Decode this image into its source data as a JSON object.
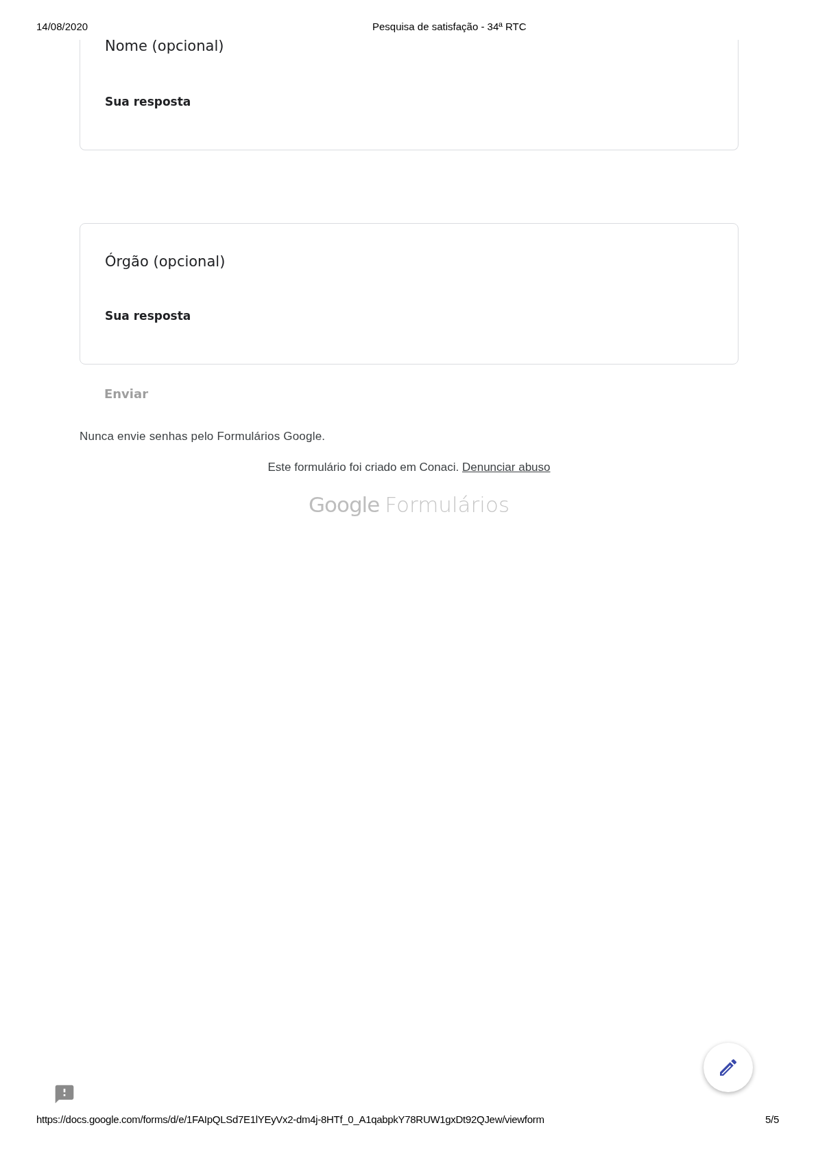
{
  "print_header": {
    "date": "14/08/2020",
    "title": "Pesquisa de satisfação - 34ª RTC"
  },
  "questions": [
    {
      "title": "Nome (opcional)",
      "placeholder": "Sua resposta",
      "top_cut": true
    },
    {
      "title": "Órgão (opcional)",
      "placeholder": "Sua resposta",
      "top_cut": false
    }
  ],
  "submit_button": {
    "label": "Enviar",
    "disabled": true
  },
  "notice": "Nunca envie senhas pelo Formulários Google.",
  "footer": {
    "text": "Este formulário foi criado em Conaci.",
    "link": "Denunciar abuso"
  },
  "logo": {
    "brand": "Google",
    "product": "Formulários"
  },
  "print_footer": {
    "url": "https://docs.google.com/forms/d/e/1FAIpQLSd7E1lYEyVx2-dm4j-8HTf_0_A1qabpkY78RUW1gxDt92QJew/viewform",
    "page": "5/5"
  }
}
